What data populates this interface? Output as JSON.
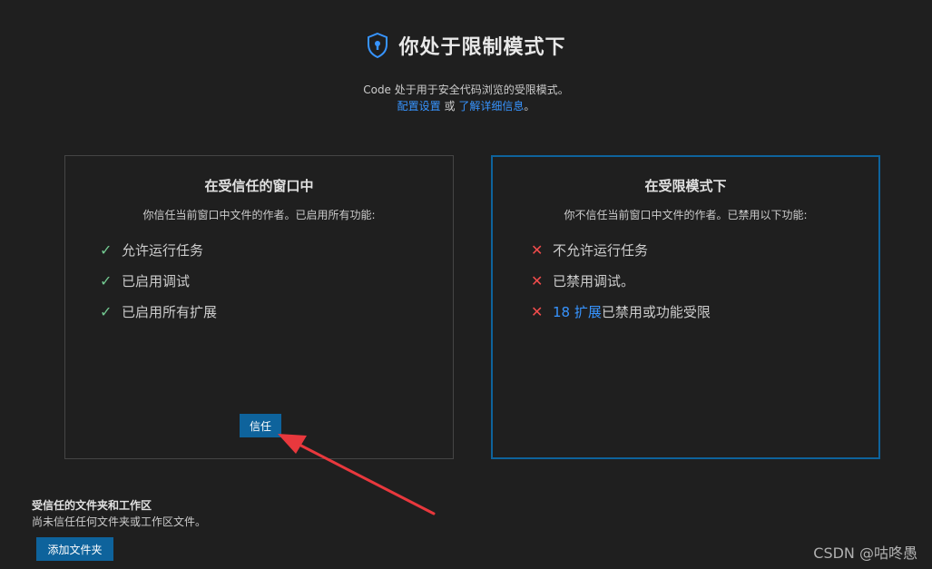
{
  "header": {
    "title": "你处于限制模式下",
    "icon": "shield-icon",
    "description_line1": "Code 处于用于安全代码浏览的受限模式。",
    "configure_link": "配置设置",
    "or_text": " 或 ",
    "learn_more_link": "了解详细信息",
    "period": "。"
  },
  "trusted_card": {
    "title": "在受信任的窗口中",
    "subtitle": "你信任当前窗口中文件的作者。已启用所有功能:",
    "items": [
      {
        "icon": "check-icon",
        "label": "允许运行任务"
      },
      {
        "icon": "check-icon",
        "label": "已启用调试"
      },
      {
        "icon": "check-icon",
        "label": "已启用所有扩展"
      }
    ],
    "button_label": "信任"
  },
  "restricted_card": {
    "title": "在受限模式下",
    "subtitle": "你不信任当前窗口中文件的作者。已禁用以下功能:",
    "items": [
      {
        "icon": "x-icon",
        "label": "不允许运行任务"
      },
      {
        "icon": "x-icon",
        "label": "已禁用调试。"
      },
      {
        "icon": "x-icon",
        "link": "18 扩展",
        "label": "已禁用或功能受限"
      }
    ]
  },
  "trusted_folders": {
    "title": "受信任的文件夹和工作区",
    "subtitle": "尚未信任任何文件夹或工作区文件。",
    "button_label": "添加文件夹"
  },
  "watermark": "CSDN @咕咚愚",
  "colors": {
    "background": "#1f1f1f",
    "accent": "#0e639c",
    "link": "#3794ff",
    "check": "#73c991",
    "cross": "#f14c4c",
    "annotation_arrow": "#e8383d"
  }
}
